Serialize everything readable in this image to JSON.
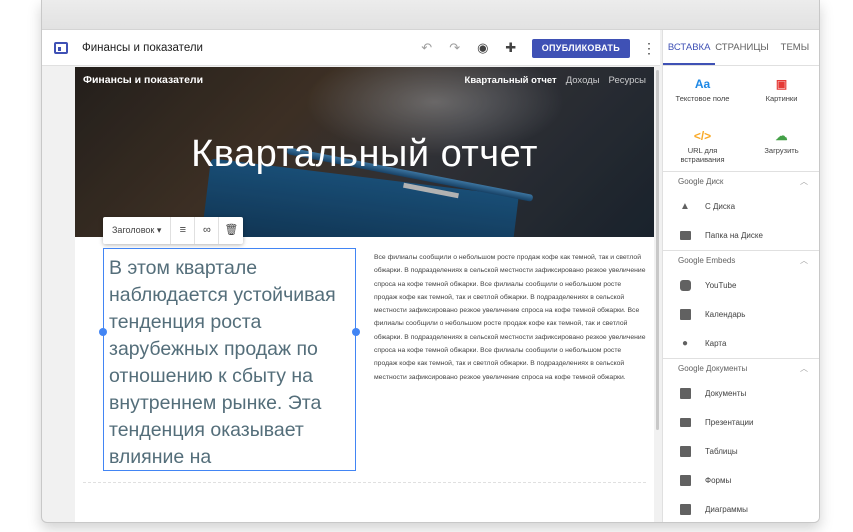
{
  "app": {
    "doc_title": "Финансы и показатели",
    "publish_label": "ОПУБЛИКОВАТЬ"
  },
  "site": {
    "name": "Финансы и показатели",
    "nav": [
      "Квартальный отчет",
      "Доходы",
      "Ресурсы"
    ],
    "hero_title": "Квартальный отчет"
  },
  "format_toolbar": {
    "style_dropdown": "Заголовок"
  },
  "content": {
    "selected_text": "В этом квартале наблюдается устойчивая тенденция роста зарубежных продаж по отношению к сбыту на внутреннем рынке. Эта тенденция оказывает влияние на",
    "body_text": "Все филиалы сообщили о небольшом росте продаж кофе как темной, так и светлой обжарки.  В подразделениях в сельской местности зафиксировано резкое увеличение спроса на кофе темной обжарки.  Все филиалы сообщили о небольшом росте продаж кофе как темной, так и светлой обжарки.  В подразделениях в сельской местности зафиксировано резкое увеличение спроса на кофе темной обжарки.  Все филиалы сообщили о небольшом росте продаж кофе как темной, так и светлой обжарки.  В подразделениях в сельской местности зафиксировано резкое увеличение спроса на кофе темной обжарки.  Все филиалы сообщили о небольшом росте продаж кофе как темной, так и светлой обжарки.  В подразделениях в сельской местности зафиксировано резкое увеличение спроса на кофе темной обжарки."
  },
  "panel": {
    "tabs": [
      "ВСТАВКА",
      "СТРАНИЦЫ",
      "ТЕМЫ"
    ],
    "insert": [
      {
        "label": "Текстовое поле",
        "icon": "text-box-icon"
      },
      {
        "label": "Картинки",
        "icon": "image-icon"
      },
      {
        "label": "URL для встраивания",
        "icon": "embed-code-icon"
      },
      {
        "label": "Загрузить",
        "icon": "upload-icon"
      }
    ],
    "sections": {
      "drive": {
        "title": "Google Диск",
        "items": [
          "С Диска",
          "Папка на Диске"
        ]
      },
      "embeds": {
        "title": "Google Embeds",
        "items": [
          "YouTube",
          "Календарь",
          "Карта"
        ]
      },
      "docs": {
        "title": "Google Документы",
        "items": [
          "Документы",
          "Презентации",
          "Таблицы",
          "Формы",
          "Диаграммы"
        ]
      }
    }
  },
  "colors": {
    "accent": "#3f51b5",
    "selection": "#4285f4",
    "text_box_text": "#546e7a"
  }
}
